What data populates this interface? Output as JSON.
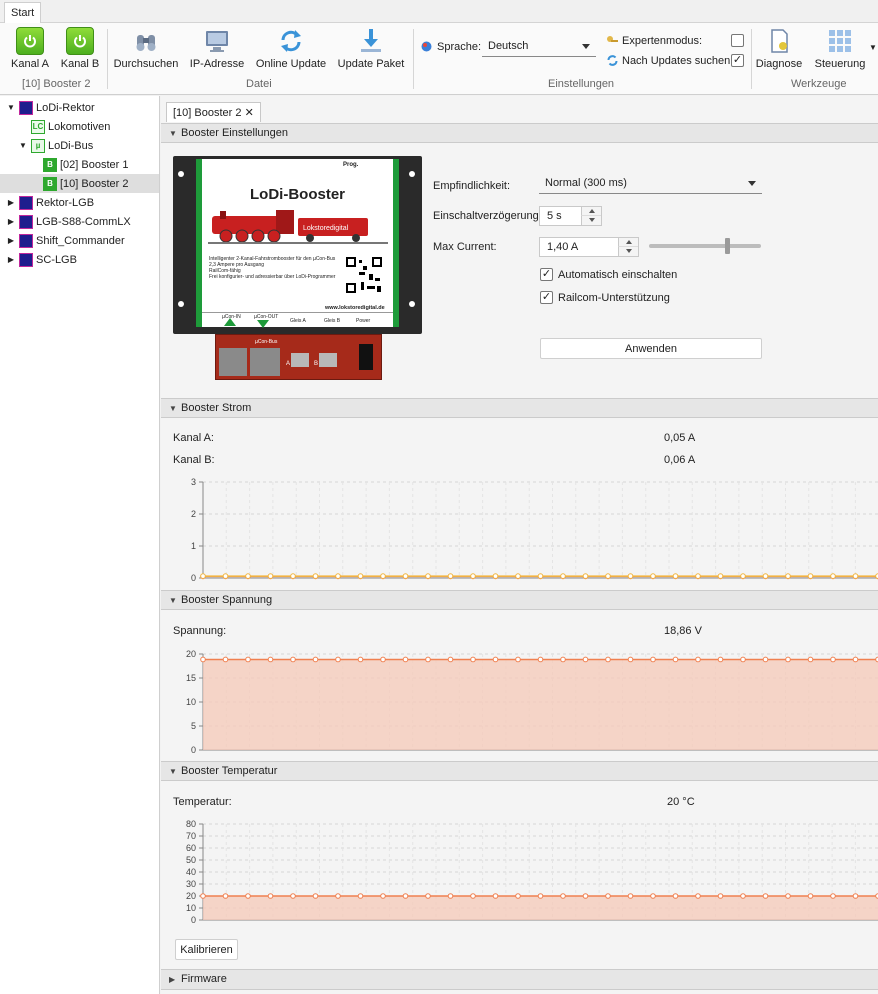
{
  "tabs": {
    "start": "Start"
  },
  "ribbon": {
    "kanal_a": "Kanal A",
    "kanal_b": "Kanal B",
    "device_label": "[10] Booster 2",
    "durchsuchen": "Durchsuchen",
    "ip_adresse": "IP-Adresse",
    "online_update": "Online Update",
    "update_paket": "Update Paket",
    "group_datei": "Datei",
    "sprache_label": "Sprache:",
    "sprache_value": "Deutsch",
    "expertenmodus": "Expertenmodus:",
    "expertenmodus_checked": false,
    "nach_updates": "Nach Updates suchen:",
    "nach_updates_checked": true,
    "group_einstellungen": "Einstellungen",
    "diagnose": "Diagnose",
    "steuerung": "Steuerung",
    "group_werkzeuge": "Werkzeuge"
  },
  "tree": [
    {
      "label": "LoDi-Rektor",
      "icon": "device-icon",
      "expanded": true
    },
    {
      "label": "Lokomotiven",
      "icon": "locomotive-icon"
    },
    {
      "label": "LoDi-Bus",
      "icon": "bus-icon",
      "expanded": true
    },
    {
      "label": "[02] Booster 1",
      "icon": "booster-icon"
    },
    {
      "label": "[10] Booster 2",
      "icon": "booster-icon",
      "selected": true
    },
    {
      "label": "Rektor-LGB",
      "icon": "device-icon"
    },
    {
      "label": "LGB-S88-CommLX",
      "icon": "device-icon"
    },
    {
      "label": "Shift_Commander",
      "icon": "device-icon"
    },
    {
      "label": "SC-LGB",
      "icon": "device-icon"
    }
  ],
  "doc_tab": {
    "label": "[10] Booster 2",
    "close": "✕"
  },
  "settings": {
    "header": "Booster Einstellungen",
    "empfindlichkeit_label": "Empfindlichkeit:",
    "empfindlichkeit_value": "Normal (300 ms)",
    "einschalt_label": "Einschaltverzögerung:",
    "einschalt_value": "5 s",
    "max_current_label": "Max Current:",
    "max_current_value": "1,40 A",
    "max_current_slider": 0.7,
    "auto_einschalten": "Automatisch einschalten",
    "auto_einschalten_checked": true,
    "railcom": "Railcom-Unterstützung",
    "railcom_checked": true,
    "anwenden": "Anwenden"
  },
  "product_image": {
    "title": "LoDi-Booster",
    "prog": "Prog.",
    "brand": "Lokstoredigital",
    "bullets": [
      "Intelligenter 2-Kanal-Fahrstrombooster für den µCon-Bus",
      "2,3 Ampere pro Ausgang",
      "RailCom-fähig",
      "Frei konfigurier- und adressierbar über LoDi-Programmer"
    ],
    "url": "www.lokstoredigital.de",
    "labels": [
      "µCon-IN",
      "µCon-OUT",
      "Gleis A",
      "Gleis B",
      "Power"
    ],
    "ports": [
      "µCon-Bus",
      "A",
      "B"
    ]
  },
  "strom": {
    "header": "Booster Strom",
    "kanal_a_label": "Kanal A:",
    "kanal_a_value": "0,05 A",
    "kanal_b_label": "Kanal B:",
    "kanal_b_value": "0,06 A"
  },
  "spannung": {
    "header": "Booster Spannung",
    "label": "Spannung:",
    "value": "18,86 V"
  },
  "temperatur": {
    "header": "Booster Temperatur",
    "label": "Temperatur:",
    "value": "20 °C",
    "kalibrieren": "Kalibrieren"
  },
  "firmware": {
    "header": "Firmware"
  },
  "colors": {
    "series_orange": "#f08050",
    "fill_orange": "#f6c9b8",
    "green": "#4caf1e"
  },
  "chart_data": [
    {
      "type": "line",
      "name_ref": "Booster Strom",
      "ylim": [
        0,
        3
      ],
      "yticks": [
        0,
        1,
        2,
        3
      ],
      "series": [
        {
          "values": [
            0.05,
            0.05,
            0.05,
            0.05,
            0.05,
            0.05,
            0.05,
            0.05,
            0.05,
            0.05,
            0.05,
            0.05,
            0.05,
            0.05,
            0.05,
            0.05,
            0.05,
            0.05,
            0.05,
            0.05,
            0.05,
            0.05,
            0.05,
            0.05,
            0.05,
            0.05,
            0.05,
            0.05,
            0.05,
            0.05,
            0.05
          ]
        },
        {
          "values": [
            0.06,
            0.06,
            0.06,
            0.06,
            0.06,
            0.06,
            0.06,
            0.06,
            0.06,
            0.06,
            0.06,
            0.06,
            0.06,
            0.06,
            0.06,
            0.06,
            0.06,
            0.06,
            0.06,
            0.06,
            0.06,
            0.06,
            0.06,
            0.06,
            0.06,
            0.06,
            0.06,
            0.06,
            0.06,
            0.06,
            0.06
          ]
        }
      ]
    },
    {
      "type": "area",
      "name_ref": "Booster Spannung",
      "ylim": [
        0,
        20
      ],
      "yticks": [
        0,
        5,
        10,
        15,
        20
      ],
      "series": [
        {
          "values": [
            18.86,
            18.86,
            18.86,
            18.86,
            18.86,
            18.86,
            18.86,
            18.86,
            18.86,
            18.86,
            18.86,
            18.86,
            18.86,
            18.86,
            18.86,
            18.86,
            18.86,
            18.86,
            18.86,
            18.86,
            18.86,
            18.86,
            18.86,
            18.86,
            18.86,
            18.86,
            18.86,
            18.86,
            18.86,
            18.86,
            18.86
          ]
        }
      ]
    },
    {
      "type": "area",
      "name_ref": "Booster Temperatur",
      "ylim": [
        0,
        80
      ],
      "yticks": [
        0,
        10,
        20,
        30,
        40,
        50,
        60,
        70,
        80
      ],
      "series": [
        {
          "values": [
            20,
            20,
            20,
            20,
            20,
            20,
            20,
            20,
            20,
            20,
            20,
            20,
            20,
            20,
            20,
            20,
            20,
            20,
            20,
            20,
            20,
            20,
            20,
            20,
            20,
            20,
            20,
            20,
            20,
            20,
            20
          ]
        }
      ]
    }
  ]
}
